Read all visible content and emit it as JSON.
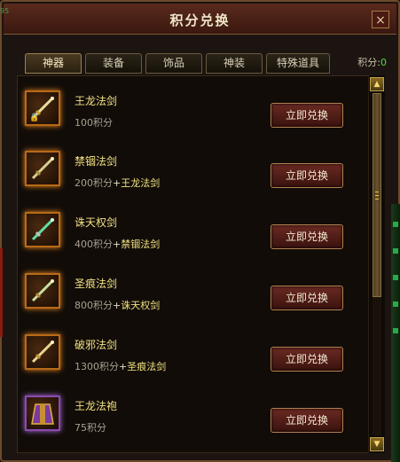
{
  "window": {
    "title": "积分兑换",
    "close_icon": "×"
  },
  "tabs": [
    {
      "label": "神器",
      "active": true
    },
    {
      "label": "装备",
      "active": false
    },
    {
      "label": "饰品",
      "active": false
    },
    {
      "label": "神装",
      "active": false
    },
    {
      "label": "特殊道具",
      "active": false
    }
  ],
  "score": {
    "label": "积分:",
    "value": "0"
  },
  "items": [
    {
      "name": "王龙法剑",
      "cost": "100积分",
      "plus": "",
      "requires": "",
      "icon": "sword-icon",
      "locked": true,
      "button": "立即兑换"
    },
    {
      "name": "禁锢法剑",
      "cost": "200积分",
      "plus": "+",
      "requires": "王龙法剑",
      "icon": "sword-icon",
      "locked": false,
      "button": "立即兑换"
    },
    {
      "name": "诛天权剑",
      "cost": "400积分",
      "plus": "+",
      "requires": "禁锢法剑",
      "icon": "sword-icon",
      "locked": false,
      "button": "立即兑换"
    },
    {
      "name": "圣痕法剑",
      "cost": "800积分",
      "plus": "+",
      "requires": "诛天权剑",
      "icon": "sword-icon",
      "locked": false,
      "button": "立即兑换"
    },
    {
      "name": "破邪法剑",
      "cost": "1300积分",
      "plus": "+",
      "requires": "圣痕法剑",
      "icon": "sword-icon",
      "locked": false,
      "button": "立即兑换"
    },
    {
      "name": "王龙法袍",
      "cost": "75积分",
      "plus": "",
      "requires": "",
      "icon": "robe-icon",
      "locked": false,
      "button": "立即兑换"
    }
  ],
  "scroll": {
    "up_icon": "▲",
    "down_icon": "▼"
  },
  "corner_text": "95",
  "colors": {
    "title_bar": "#5a2a1c",
    "item_name": "#f0e080",
    "score_value": "#48e048",
    "button": "#6a2a22"
  }
}
